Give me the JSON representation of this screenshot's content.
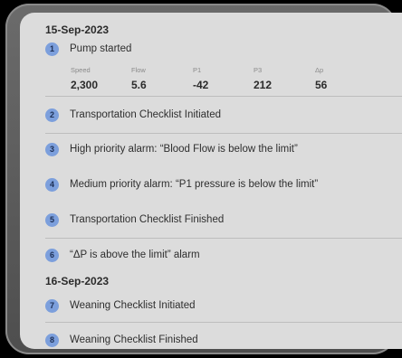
{
  "groups": [
    {
      "date": "15-Sep-2023"
    },
    {
      "date": "16-Sep-2023"
    }
  ],
  "events": [
    {
      "num": "1",
      "text": "Pump started"
    },
    {
      "num": "2",
      "text": "Transportation Checklist Initiated"
    },
    {
      "num": "3",
      "text": "High priority alarm: “Blood Flow is below the limit”"
    },
    {
      "num": "4",
      "text": "Medium priority alarm: “P1 pressure is below the limit”"
    },
    {
      "num": "5",
      "text": "Transportation Checklist Finished"
    },
    {
      "num": "6",
      "text": "“ΔP is above the limit” alarm"
    },
    {
      "num": "7",
      "text": "Weaning Checklist Initiated"
    },
    {
      "num": "8",
      "text": "Weaning Checklist Finished"
    }
  ],
  "params": [
    {
      "label": "Speed",
      "value": "2,300"
    },
    {
      "label": "Flow",
      "value": "5.6"
    },
    {
      "label": "P1",
      "value": "-42"
    },
    {
      "label": "P3",
      "value": "212"
    },
    {
      "label": "Δp",
      "value": "56"
    }
  ],
  "colors": {
    "badge": "#7c9fdc",
    "screen": "#dcdcdc",
    "frame": "#5a5a5a"
  }
}
